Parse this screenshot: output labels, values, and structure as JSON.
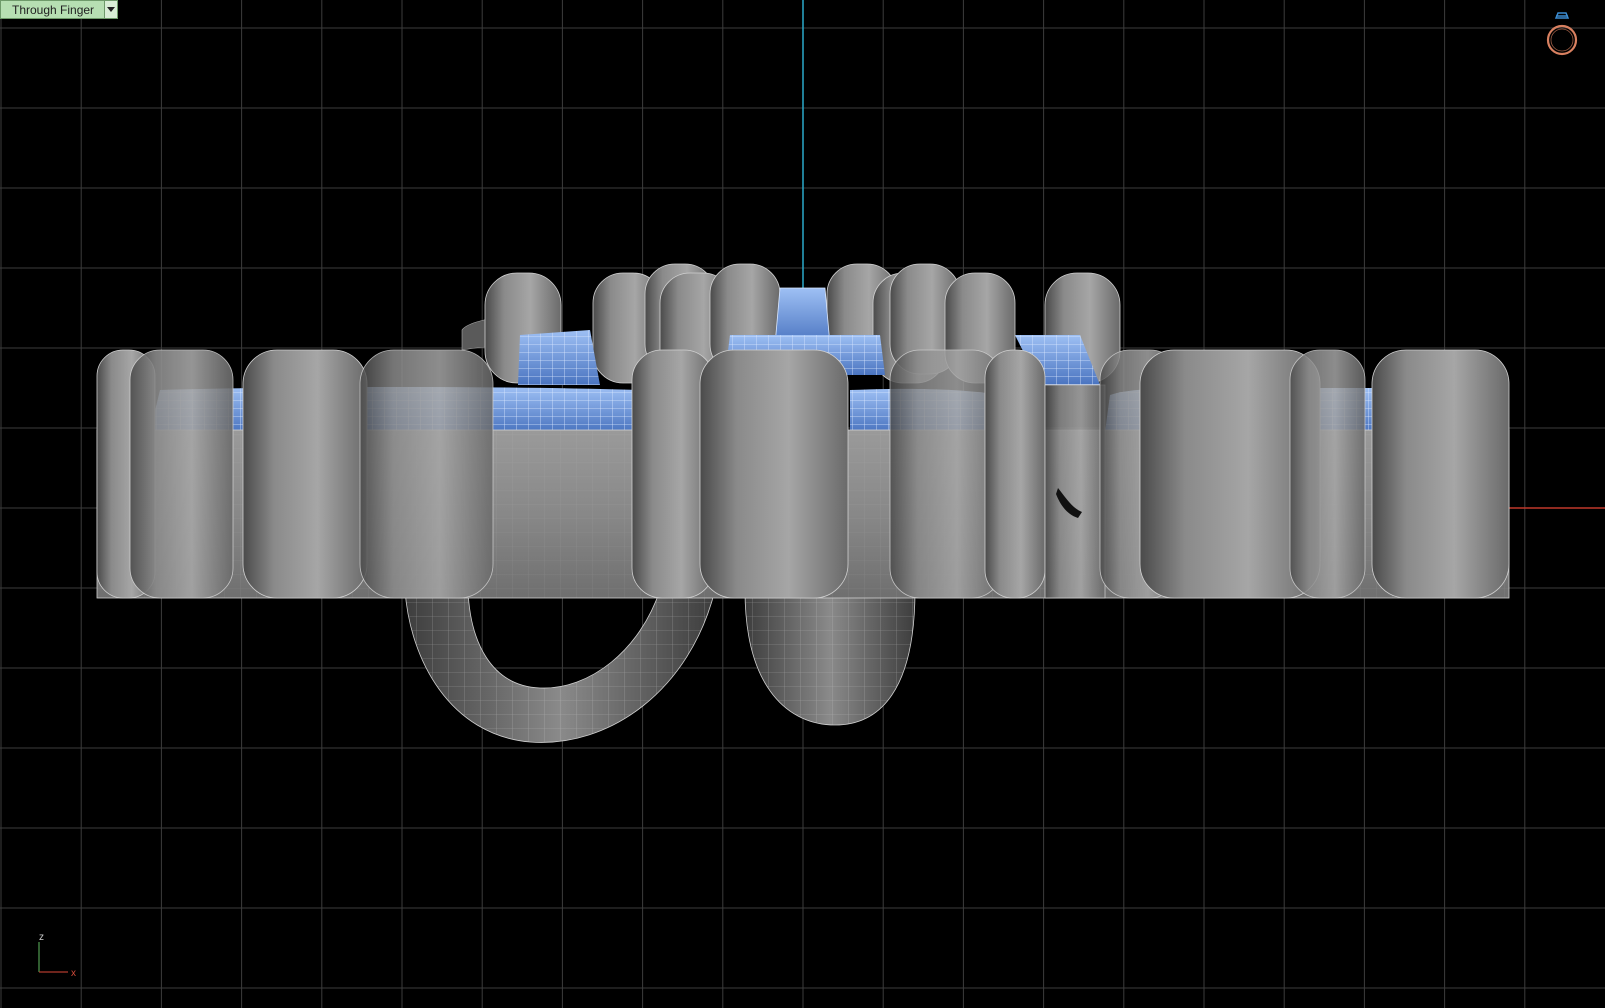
{
  "viewport": {
    "name": "Through Finger",
    "background": "#000000",
    "grid_color": "#3c3c3c",
    "x_axis_color": "#c0392b",
    "z_axis_color": "#2aa9c9",
    "selected_color": "#5b86d6",
    "object_color": "#8c8c8c"
  },
  "gizmo": {
    "vertical_label": "z",
    "horizontal_label": "x"
  },
  "icons": {
    "ring": "ring-icon",
    "dropdown": "chevron-down-icon"
  }
}
